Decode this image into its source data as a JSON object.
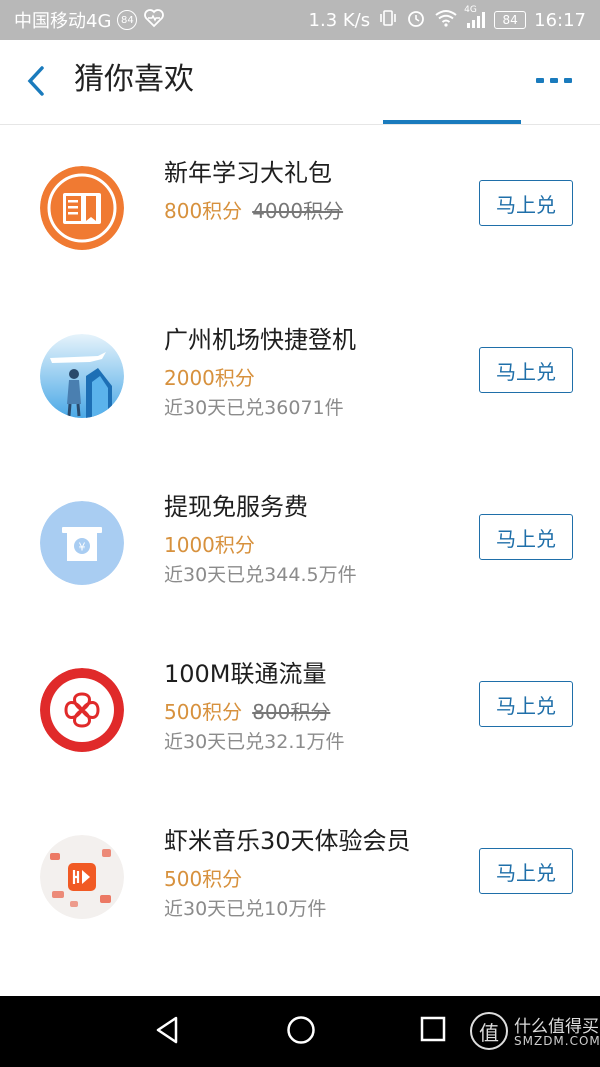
{
  "status_bar": {
    "carrier": "中国移动4G",
    "badge": "84",
    "speed": "1.3 K/s",
    "network": "4G",
    "battery": "84",
    "time": "16:17"
  },
  "header": {
    "title": "猜你喜欢"
  },
  "items": [
    {
      "title": "新年学习大礼包",
      "points": "800积分",
      "original_points": "4000积分",
      "redeemed": "",
      "button": "马上兑",
      "icon": "book-icon",
      "color": "#f07a32"
    },
    {
      "title": "广州机场快捷登机",
      "points": "2000积分",
      "original_points": "",
      "redeemed": "近30天已兑36071件",
      "button": "马上兑",
      "icon": "airport-boarding-icon",
      "color": "#4aa8e6"
    },
    {
      "title": "提现免服务费",
      "points": "1000积分",
      "original_points": "",
      "redeemed": "近30天已兑344.5万件",
      "button": "马上兑",
      "icon": "atm-yuan-icon",
      "color": "#a9cdf2"
    },
    {
      "title": "100M联通流量",
      "points": "500积分",
      "original_points": "800积分",
      "redeemed": "近30天已兑32.1万件",
      "button": "马上兑",
      "icon": "china-unicom-icon",
      "color": "#e02a2a"
    },
    {
      "title": "虾米音乐30天体验会员",
      "points": "500积分",
      "original_points": "",
      "redeemed": "近30天已兑10万件",
      "button": "马上兑",
      "icon": "xiami-music-icon",
      "color": "#f15a24"
    }
  ],
  "watermark": {
    "glyph": "值",
    "text": "什么值得买",
    "domain": "SMZDM.COM"
  }
}
